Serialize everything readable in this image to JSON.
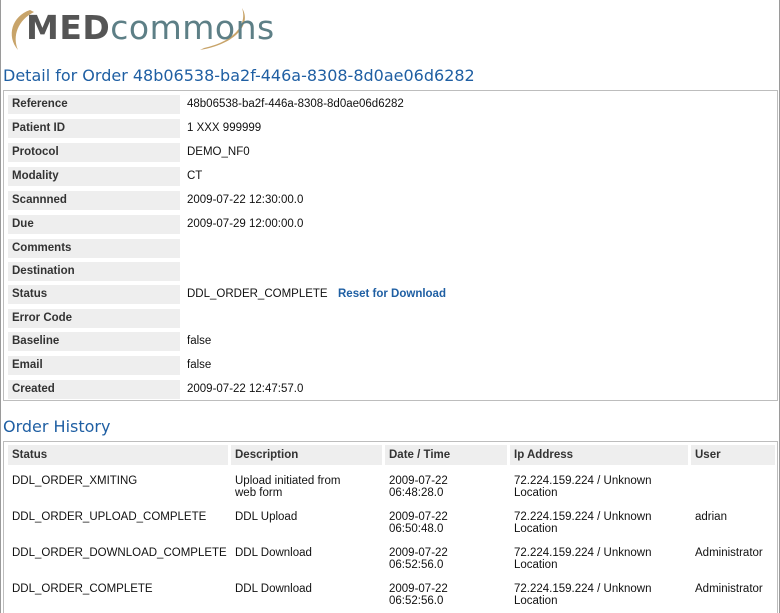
{
  "logo": {
    "med": "MED",
    "commons": "commons"
  },
  "detail": {
    "title": "Detail for Order 48b06538-ba2f-446a-8308-8d0ae06d6282",
    "rows": [
      {
        "label": "Reference",
        "value": "48b06538-ba2f-446a-8308-8d0ae06d6282"
      },
      {
        "label": "Patient ID",
        "value": "1 XXX 999999"
      },
      {
        "label": "Protocol",
        "value": "DEMO_NF0"
      },
      {
        "label": "Modality",
        "value": "CT"
      },
      {
        "label": "Scannned",
        "value": "2009-07-22 12:30:00.0"
      },
      {
        "label": "Due",
        "value": "2009-07-29 12:00:00.0"
      },
      {
        "label": "Comments",
        "value": ""
      },
      {
        "label": "Destination",
        "value": ""
      },
      {
        "label": "Status",
        "value": "DDL_ORDER_COMPLETE"
      },
      {
        "label": "Error Code",
        "value": ""
      },
      {
        "label": "Baseline",
        "value": "false"
      },
      {
        "label": "Email",
        "value": "false"
      },
      {
        "label": "Created",
        "value": "2009-07-22 12:47:57.0"
      }
    ],
    "reset_link": "Reset for Download"
  },
  "history": {
    "title": "Order History",
    "columns": [
      "Status",
      "Description",
      "Date / Time",
      "Ip Address",
      "User"
    ],
    "rows": [
      {
        "status": "DDL_ORDER_XMITING",
        "desc1": "Upload initiated from",
        "desc2": "web form",
        "date1": "2009-07-22",
        "date2": "06:48:28.0",
        "ip1": "72.224.159.224 / Unknown",
        "ip2": "Location",
        "user": ""
      },
      {
        "status": "DDL_ORDER_UPLOAD_COMPLETE",
        "desc1": "DDL Upload",
        "desc2": "",
        "date1": "2009-07-22",
        "date2": "06:50:48.0",
        "ip1": "72.224.159.224 / Unknown",
        "ip2": "Location",
        "user": "adrian"
      },
      {
        "status": "DDL_ORDER_DOWNLOAD_COMPLETE",
        "desc1": "DDL Download",
        "desc2": "",
        "date1": "2009-07-22",
        "date2": "06:52:56.0",
        "ip1": "72.224.159.224 / Unknown",
        "ip2": "Location",
        "user": "Administrator"
      },
      {
        "status": "DDL_ORDER_COMPLETE",
        "desc1": "DDL Download",
        "desc2": "",
        "date1": "2009-07-22",
        "date2": "06:52:56.0",
        "ip1": "72.224.159.224 / Unknown",
        "ip2": "Location",
        "user": "Administrator"
      }
    ]
  }
}
